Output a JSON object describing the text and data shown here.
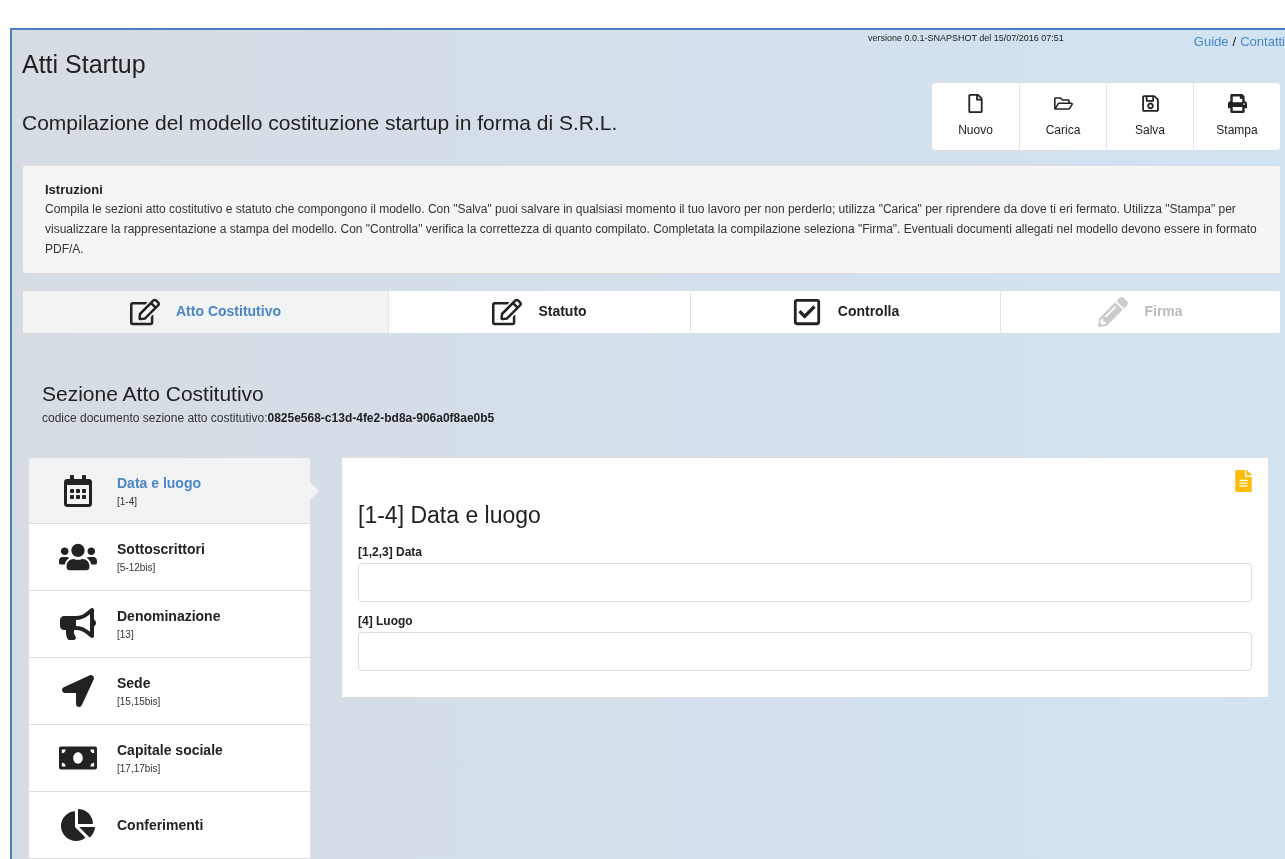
{
  "header": {
    "title": "Atti Startup",
    "version": "versione 0.0.1-SNAPSHOT del 15/07/2016 07:51",
    "links": [
      "Guide",
      "Contatti"
    ],
    "link_separator": "/",
    "subtitle": "Compilazione del modello costituzione startup in forma di S.R.L."
  },
  "toolbar": [
    "Nuovo",
    "Carica",
    "Salva",
    "Stampa"
  ],
  "instructions": {
    "title": "Istruzioni",
    "text": "Compila le sezioni atto costitutivo e statuto che compongono il modello. Con \"Salva\" puoi salvare in qualsiasi momento il tuo lavoro per non perderlo; utilizza \"Carica\" per riprendere da dove ti eri fermato. Utilizza \"Stampa\" per visualizzare la rappresentazione a stampa del modello. Con \"Controlla\" verifica la correttezza di quanto compilato. Completata la compilazione seleziona \"Firma\". Eventuali documenti allegati nel modello devono essere in formato PDF/A."
  },
  "steps": [
    {
      "label": "Atto Costitutivo",
      "selected": true,
      "disabled": false
    },
    {
      "label": "Statuto",
      "selected": false,
      "disabled": false
    },
    {
      "label": "Controlla",
      "selected": false,
      "disabled": false
    },
    {
      "label": "Firma",
      "selected": false,
      "disabled": true
    }
  ],
  "section": {
    "title": "Sezione Atto Costitutivo",
    "code_label": "codice documento sezione atto costitutivo:",
    "code": "0825e568-c13d-4fe2-bd8a-906a0f8ae0b5"
  },
  "sidebar": [
    {
      "label": "Data e luogo",
      "code": "[1-4]",
      "selected": true
    },
    {
      "label": "Sottoscrittori",
      "code": "[5-12bis]",
      "selected": false
    },
    {
      "label": "Denominazione",
      "code": "[13]",
      "selected": false
    },
    {
      "label": "Sede",
      "code": "[15,15bis]",
      "selected": false
    },
    {
      "label": "Capitale sociale",
      "code": "[17,17bis]",
      "selected": false
    },
    {
      "label": "Conferimenti",
      "selected": false
    }
  ],
  "form": {
    "title": "[1-4] Data e luogo",
    "fields": [
      {
        "label": "[1,2,3] Data"
      },
      {
        "label": "[4] Luogo"
      }
    ]
  }
}
